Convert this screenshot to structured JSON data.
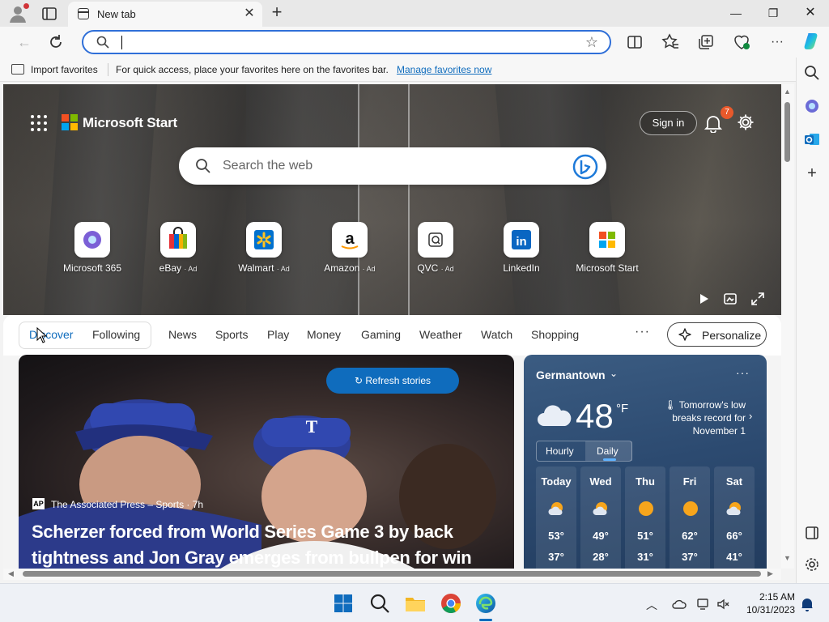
{
  "browser": {
    "tab_title": "New tab",
    "tab_icon": "newtab-page-icon",
    "address_value": "",
    "window_controls": [
      "minimize",
      "restore",
      "close"
    ]
  },
  "favorites_bar": {
    "import_label": "Import favorites",
    "hint": "For quick access, place your favorites here on the favorites bar.",
    "manage_link": "Manage favorites now"
  },
  "start": {
    "brand": "Microsoft Start",
    "sign_in": "Sign in",
    "notification_count": "7",
    "search_placeholder": "Search the web",
    "quick_links": [
      {
        "label": "Microsoft 365",
        "ad": ""
      },
      {
        "label": "eBay",
        "ad": "· Ad"
      },
      {
        "label": "Walmart",
        "ad": "· Ad"
      },
      {
        "label": "Amazon",
        "ad": "· Ad"
      },
      {
        "label": "QVC",
        "ad": "· Ad"
      },
      {
        "label": "LinkedIn",
        "ad": ""
      },
      {
        "label": "Microsoft Start",
        "ad": ""
      }
    ]
  },
  "feed_nav": {
    "items": [
      "Discover",
      "Following",
      "News",
      "Sports",
      "Play",
      "Money",
      "Gaming",
      "Weather",
      "Watch",
      "Shopping"
    ],
    "more": "···",
    "personalize": "Personalize"
  },
  "story": {
    "refresh_label": "Refresh stories",
    "source_logo": "AP",
    "source": "The Associated Press – Sports · 7h",
    "title": "Scherzer forced from World Series Game 3 by back tightness and Jon Gray emerges from bullpen for win"
  },
  "weather": {
    "location": "Germantown",
    "temp": "48",
    "unit": "°F",
    "alert": "Tomorrow's low breaks record for November 1",
    "tabs": [
      "Hourly",
      "Daily"
    ],
    "active_tab": "Daily",
    "days": [
      {
        "name": "Today",
        "hi": "53°",
        "lo": "37°",
        "icon": "partly-sunny-icon"
      },
      {
        "name": "Wed",
        "hi": "49°",
        "lo": "28°",
        "icon": "partly-sunny-icon"
      },
      {
        "name": "Thu",
        "hi": "51°",
        "lo": "31°",
        "icon": "sunny-icon"
      },
      {
        "name": "Fri",
        "hi": "62°",
        "lo": "37°",
        "icon": "sunny-icon"
      },
      {
        "name": "Sat",
        "hi": "66°",
        "lo": "41°",
        "icon": "partly-sunny-icon"
      }
    ]
  },
  "taskbar": {
    "time": "2:15 AM",
    "date": "10/31/2023"
  },
  "colors": {
    "accent": "#0f6cbd",
    "address_border": "#2f6fd8",
    "badge": "#e8592b"
  }
}
